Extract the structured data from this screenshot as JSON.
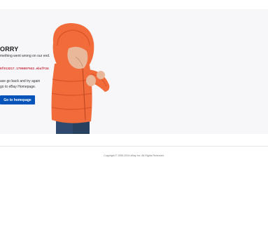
{
  "error": {
    "title": "ORRY",
    "message": "mething went wrong on our end.",
    "error_id": "0f013217.1706007943.ebafF24",
    "note_line1": "ase go back and try again",
    "note_line2": "go to eBay Homepage.",
    "button_label": "Go to homepage"
  },
  "footer": {
    "copyright": "Copyright © 1995-2024 eBay Inc. All Rights Reserved."
  },
  "colors": {
    "button_bg": "#0654ba",
    "error_id": "#c4293d",
    "jacket": "#f26b3a",
    "panel_bg": "#f7f7f9"
  }
}
